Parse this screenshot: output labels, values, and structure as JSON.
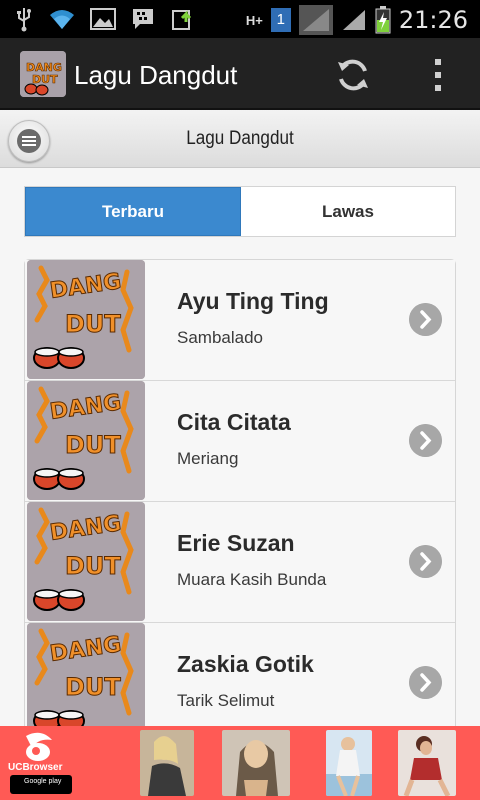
{
  "status_bar": {
    "time": "21:26",
    "sim_badge": "1",
    "network_type": "H+",
    "icons": [
      "usb-icon",
      "wifi-icon",
      "gallery-icon",
      "bbm-icon",
      "upload-icon",
      "signal-icon",
      "battery-charging-icon"
    ]
  },
  "app_bar": {
    "title": "Lagu Dangdut",
    "actions": [
      "refresh-icon",
      "overflow-menu-icon"
    ]
  },
  "sub_header": {
    "title": "Lagu Dangdut",
    "menu_icon": "hamburger-menu-icon"
  },
  "tabs": [
    {
      "label": "Terbaru",
      "active": true
    },
    {
      "label": "Lawas",
      "active": false
    }
  ],
  "songs": [
    {
      "artist": "Ayu Ting Ting",
      "title": "Sambalado"
    },
    {
      "artist": "Cita Citata",
      "title": "Meriang"
    },
    {
      "artist": "Erie Suzan",
      "title": "Muara Kasih Bunda"
    },
    {
      "artist": "Zaskia Gotik",
      "title": "Tarik Selimut"
    }
  ],
  "ad_banner": {
    "brand": "UCBrowser",
    "store_badge": "Google play",
    "background_color": "#ff5a55"
  },
  "colors": {
    "accent": "#3b89cf",
    "app_bar": "#222222"
  }
}
